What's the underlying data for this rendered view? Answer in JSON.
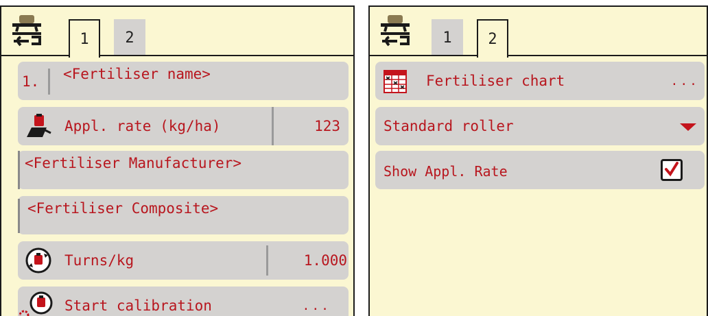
{
  "colors": {
    "panel_bg": "#fbf7d2",
    "row_bg": "#d4d2d0",
    "text_red": "#b8161e",
    "accent_red": "#c4141c"
  },
  "left_panel": {
    "tabs": [
      {
        "label": "1",
        "active": true
      },
      {
        "label": "2",
        "active": false
      }
    ],
    "rows": {
      "fertiliser_name": {
        "index": "1.",
        "label": "<Fertiliser name>"
      },
      "appl_rate": {
        "icon": "scale-weight-icon",
        "label": "Appl. rate (kg/ha)",
        "value": "123"
      },
      "manufacturer": {
        "label": "<Fertiliser Manufacturer>"
      },
      "composite": {
        "label": "<Fertiliser Composite>"
      },
      "turns": {
        "icon": "turns-per-kg-icon",
        "label": "Turns/kg",
        "value": "1.000"
      },
      "calibration": {
        "icon": "calibration-gears-icon",
        "label": "Start calibration",
        "action": "..."
      }
    }
  },
  "right_panel": {
    "tabs": [
      {
        "label": "1",
        "active": false
      },
      {
        "label": "2",
        "active": true
      }
    ],
    "rows": {
      "chart": {
        "icon": "fertiliser-chart-icon",
        "label": "Fertiliser chart",
        "action": "..."
      },
      "roller": {
        "label": "Standard roller",
        "icon": "dropdown-arrow-icon"
      },
      "show_rate": {
        "label": "Show Appl. Rate",
        "checked": true
      }
    }
  }
}
